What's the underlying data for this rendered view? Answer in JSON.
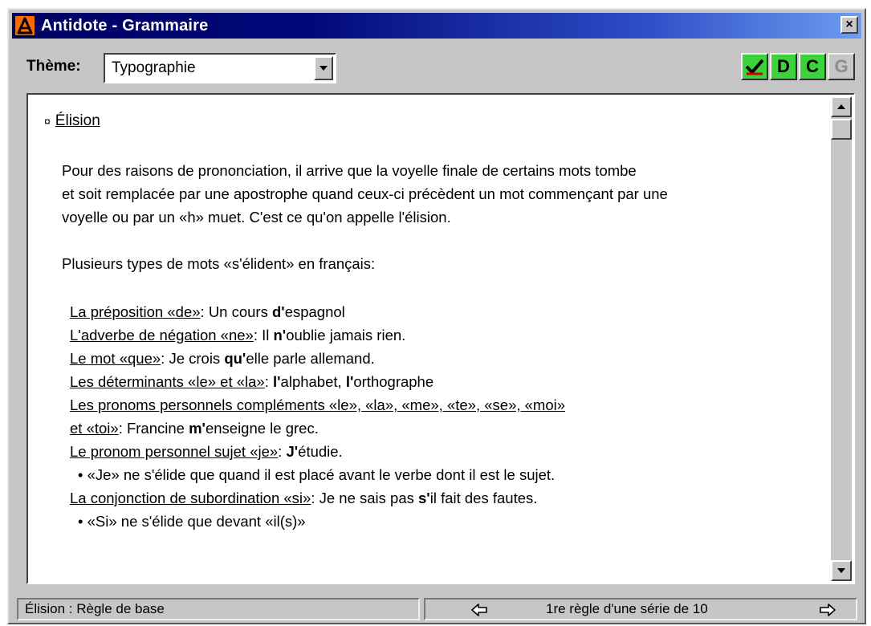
{
  "window": {
    "title": "Antidote - Grammaire",
    "close_label": "×"
  },
  "theme": {
    "label": "Thème:",
    "selected": "Typographie"
  },
  "tools": {
    "btn_check": "check-icon",
    "btn_d": "D",
    "btn_c": "C",
    "btn_g": "G"
  },
  "content": {
    "heading": "Élision",
    "paragraph1_line1": "Pour des raisons de prononciation, il arrive que la voyelle finale de certains mots tombe",
    "paragraph1_line2": "et soit remplacée par une apostrophe quand ceux-ci précèdent un mot commençant par une",
    "paragraph1_line3": "voyelle ou par un «h» muet. C'est ce qu'on appelle l'élision.",
    "paragraph2": "Plusieurs types de mots «s'élident» en français:",
    "rules": [
      {
        "label": "La préposition «de»",
        "sep": ":  ",
        "pre": "Un cours ",
        "bold": "d'",
        "post": "espagnol"
      },
      {
        "label": "L'adverbe de négation «ne»",
        "sep": ":  ",
        "pre": "Il ",
        "bold": "n'",
        "post": "oublie jamais rien."
      },
      {
        "label": "Le mot «que»",
        "sep": ":  ",
        "pre": "Je crois ",
        "bold": "qu'",
        "post": "elle parle allemand."
      },
      {
        "label": "Les déterminants «le» et «la»",
        "sep": ": ",
        "pre": "",
        "bold": "l'",
        "post": "alphabet, ",
        "bold2": "l'",
        "post2": "orthographe"
      },
      {
        "label": "Les pronoms personnels compléments «le», «la», «me», «te», «se», «moi»",
        "sep": "",
        "pre": "",
        "bold": "",
        "post": ""
      },
      {
        "label": "et «toi»",
        "sep": ":  ",
        "pre": "Francine ",
        "bold": "m'",
        "post": "enseigne le grec."
      },
      {
        "label": "Le pronom personnel sujet «je»",
        "sep": ":  ",
        "pre": "",
        "bold": "J'",
        "post": "étudie."
      }
    ],
    "note1": "• «Je» ne s'élide que quand il est placé avant le verbe dont il est le sujet.",
    "rule_si": {
      "label": "La conjonction de subordination «si»",
      "sep": ":  ",
      "pre": "Je ne sais pas ",
      "bold": "s'",
      "post": "il fait des fautes."
    },
    "note2": "• «Si» ne s'élide que devant «il(s)»"
  },
  "status": {
    "left": "Élision : Règle de base",
    "series": "1re règle d'une série de 10"
  },
  "colors": {
    "title_gradient_start": "#000060",
    "title_gradient_end": "#6d9cf0",
    "tool_green": "#3cd23c",
    "face": "#c6c6c6"
  }
}
